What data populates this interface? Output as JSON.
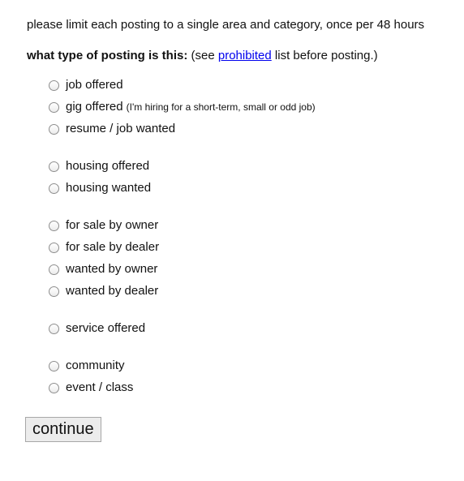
{
  "notice": "please limit each posting to a single area and category, once per 48 hours",
  "question": {
    "label": "what type of posting is this:",
    "prefix": " (see ",
    "link_text": "prohibited",
    "suffix": " list before posting.)"
  },
  "options": [
    {
      "label": "job offered",
      "note": ""
    },
    {
      "label": "gig offered",
      "note": "(I'm hiring for a short-term, small or odd job)"
    },
    {
      "label": "resume / job wanted",
      "note": ""
    },
    {
      "label": "housing offered",
      "note": ""
    },
    {
      "label": "housing wanted",
      "note": ""
    },
    {
      "label": "for sale by owner",
      "note": ""
    },
    {
      "label": "for sale by dealer",
      "note": ""
    },
    {
      "label": "wanted by owner",
      "note": ""
    },
    {
      "label": "wanted by dealer",
      "note": ""
    },
    {
      "label": "service offered",
      "note": ""
    },
    {
      "label": "community",
      "note": ""
    },
    {
      "label": "event / class",
      "note": ""
    }
  ],
  "continue_label": "continue",
  "colors": {
    "link": "#0000ee",
    "text": "#111111",
    "button_bg": "#ececec"
  }
}
